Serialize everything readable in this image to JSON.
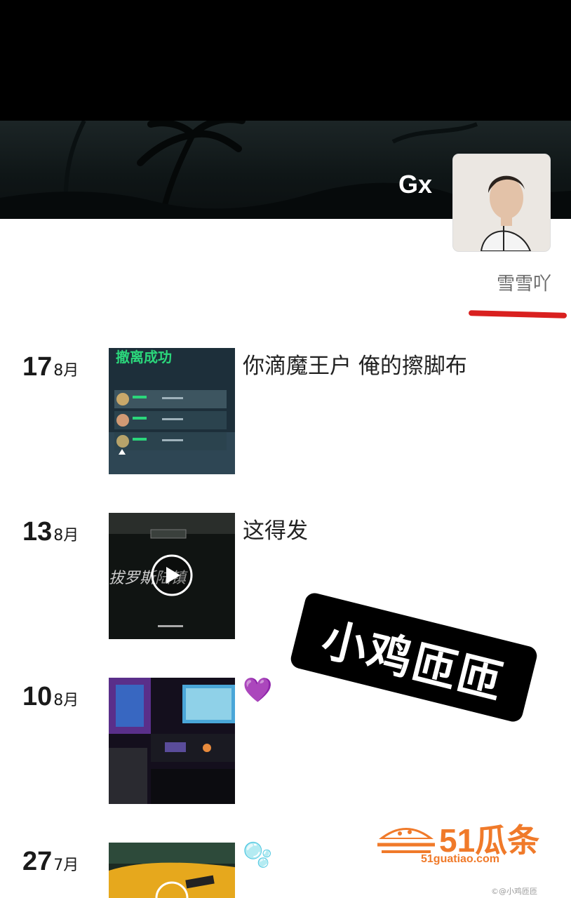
{
  "profile": {
    "username": "Gx",
    "signature": "雪雪吖"
  },
  "posts": [
    {
      "day": "17",
      "month": "8月",
      "caption": "你滴魔王户 俺的擦脚布",
      "thumb": "game-result-screenshot"
    },
    {
      "day": "13",
      "month": "8月",
      "caption": "这得发",
      "thumb": "video",
      "game_text": "拔罗斯陆镇"
    },
    {
      "day": "10",
      "month": "8月",
      "emoji": "💜",
      "thumb": "gaming-desk-photo"
    },
    {
      "day": "27",
      "month": "7月",
      "emoji": "🫧",
      "thumb": "car-photo"
    }
  ],
  "sticker": {
    "text": "小鸡匝匝"
  },
  "watermark": {
    "brand": "51瓜条",
    "url": "51guatiao.com"
  },
  "footer": {
    "text": "©@小鸡匝匝"
  },
  "colors": {
    "accent_red": "#d9201f",
    "watermark_orange": "#f07a2a"
  },
  "icons": [
    "play-icon",
    "purple-heart-icon",
    "bubbles-icon",
    "watermelon-logo-icon"
  ]
}
